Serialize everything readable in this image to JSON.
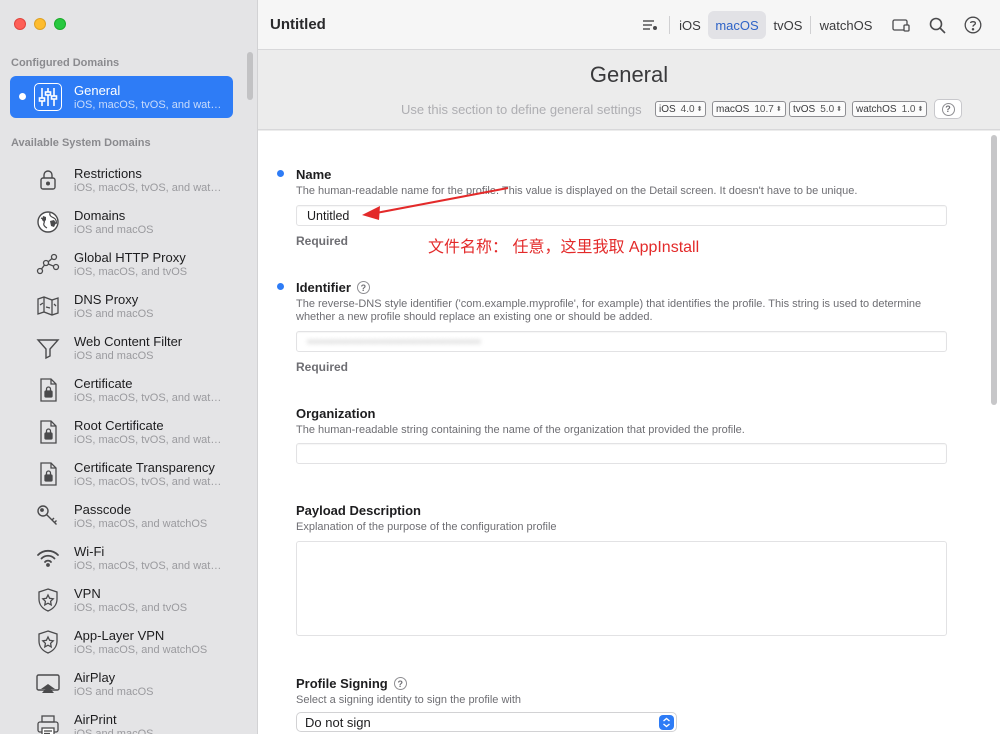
{
  "sidebar": {
    "configured_heading": "Configured Domains",
    "available_heading": "Available System Domains",
    "configured": [
      {
        "title": "General",
        "sub": "iOS, macOS, tvOS, and watchOS",
        "icon": "sliders-icon"
      }
    ],
    "available": [
      {
        "title": "Restrictions",
        "sub": "iOS, macOS, tvOS, and watchOS",
        "icon": "lock-icon"
      },
      {
        "title": "Domains",
        "sub": "iOS and macOS",
        "icon": "globe-icon"
      },
      {
        "title": "Global HTTP Proxy",
        "sub": "iOS, macOS, and tvOS",
        "icon": "proxy-nodes-icon"
      },
      {
        "title": "DNS Proxy",
        "sub": "iOS and macOS",
        "icon": "map-icon"
      },
      {
        "title": "Web Content Filter",
        "sub": "iOS and macOS",
        "icon": "funnel-icon"
      },
      {
        "title": "Certificate",
        "sub": "iOS, macOS, tvOS, and watchOS",
        "icon": "certificate-icon"
      },
      {
        "title": "Root Certificate",
        "sub": "iOS, macOS, tvOS, and watchOS",
        "icon": "certificate-icon"
      },
      {
        "title": "Certificate Transparency",
        "sub": "iOS, macOS, tvOS, and watchOS",
        "icon": "certificate-icon"
      },
      {
        "title": "Passcode",
        "sub": "iOS, macOS, and watchOS",
        "icon": "key-icon"
      },
      {
        "title": "Wi-Fi",
        "sub": "iOS, macOS, tvOS, and watchOS",
        "icon": "wifi-icon"
      },
      {
        "title": "VPN",
        "sub": "iOS, macOS, and tvOS",
        "icon": "shield-icon"
      },
      {
        "title": "App-Layer VPN",
        "sub": "iOS, macOS, and watchOS",
        "icon": "shield-icon"
      },
      {
        "title": "AirPlay",
        "sub": "iOS and macOS",
        "icon": "airplay-icon"
      },
      {
        "title": "AirPrint",
        "sub": "iOS and macOS",
        "icon": "printer-icon"
      }
    ]
  },
  "toolbar": {
    "title": "Untitled",
    "platforms": [
      "iOS",
      "macOS",
      "tvOS",
      "watchOS"
    ],
    "active_platform": "macOS"
  },
  "header": {
    "title": "General",
    "description": "Use this section to define general settings",
    "versions": [
      {
        "os": "iOS",
        "version": "4.0"
      },
      {
        "os": "macOS",
        "version": "10.7"
      },
      {
        "os": "tvOS",
        "version": "5.0"
      },
      {
        "os": "watchOS",
        "version": "1.0"
      }
    ]
  },
  "form": {
    "name": {
      "label": "Name",
      "help": "The human-readable name for the profile. This value is displayed on the Detail screen. It doesn't have to be unique.",
      "value": "Untitled",
      "required": "Required"
    },
    "identifier": {
      "label": "Identifier",
      "help": "The reverse-DNS style identifier ('com.example.myprofile', for example) that identifies the profile. This string is used to determine whether a new profile should replace an existing one or should be added.",
      "value": "●●●●●●●●●●●●●●●●●●●●●●●●●●●●●●●●●●●●",
      "required": "Required"
    },
    "organization": {
      "label": "Organization",
      "help": "The human-readable string containing the name of the organization that provided the profile.",
      "value": ""
    },
    "payload_description": {
      "label": "Payload Description",
      "help": "Explanation of the purpose of the configuration profile",
      "value": ""
    },
    "profile_signing": {
      "label": "Profile Signing",
      "help": "Select a signing identity to sign the profile with",
      "value": "Do not sign"
    }
  },
  "annotation": {
    "text": "文件名称：  任意，这里我取 AppInstall",
    "color": "#e32a2a"
  },
  "colors": {
    "accent": "#2e7cf6",
    "annotation": "#e32a2a"
  }
}
